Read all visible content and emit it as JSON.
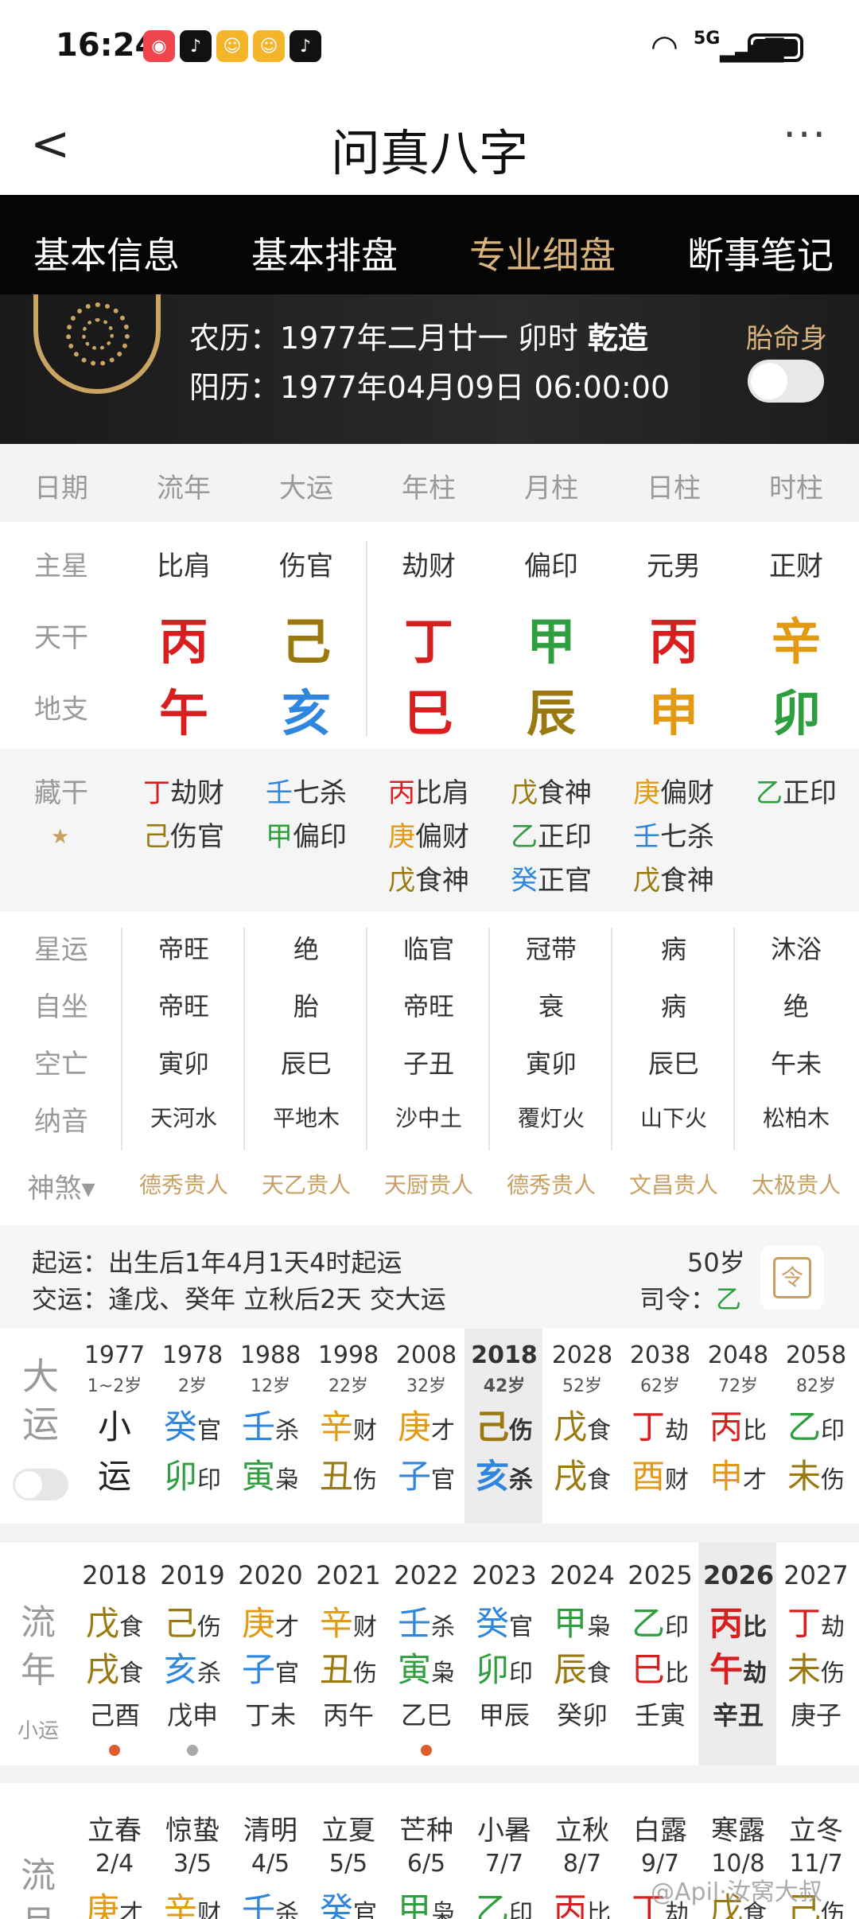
{
  "status": {
    "time": "16:24",
    "network": "5G"
  },
  "header": {
    "title": "问真八字",
    "back": "<",
    "more": "···"
  },
  "tabs": [
    {
      "label": "基本信息",
      "active": false
    },
    {
      "label": "基本排盘",
      "active": false
    },
    {
      "label": "专业细盘",
      "active": true
    },
    {
      "label": "断事笔记",
      "active": false
    }
  ],
  "info": {
    "lunar": "农历：1977年二月廿一 卯时",
    "lunar_tag": "乾造",
    "solar": "阳历：1977年04月09日 06:00:00",
    "taiming": "胎命身"
  },
  "columns": [
    "日期",
    "流年",
    "大运",
    "年柱",
    "月柱",
    "日柱",
    "时柱"
  ],
  "row_labels": {
    "zhuxing": "主星",
    "tiangan": "天干",
    "dizhi": "地支",
    "canggan": "藏干"
  },
  "zhuxing": [
    "比肩",
    "伤官",
    "劫财",
    "偏印",
    "元男",
    "正财"
  ],
  "tiangan": [
    {
      "t": "丙",
      "color": "#d81e1e"
    },
    {
      "t": "己",
      "color": "#9a7a10"
    },
    {
      "t": "丁",
      "color": "#d81e1e"
    },
    {
      "t": "甲",
      "color": "#2e9e3e"
    },
    {
      "t": "丙",
      "color": "#d81e1e"
    },
    {
      "t": "辛",
      "color": "#e39a12"
    }
  ],
  "dizhi": [
    {
      "t": "午",
      "color": "#d81e1e"
    },
    {
      "t": "亥",
      "color": "#2e86de"
    },
    {
      "t": "巳",
      "color": "#d81e1e"
    },
    {
      "t": "辰",
      "color": "#9a7a10"
    },
    {
      "t": "申",
      "color": "#e39a12"
    },
    {
      "t": "卯",
      "color": "#2e9e3e"
    }
  ],
  "canggan": [
    [
      {
        "g": "丁",
        "c": "#d81e1e",
        "s": "劫财"
      },
      {
        "g": "己",
        "c": "#9a7a10",
        "s": "伤官"
      }
    ],
    [
      {
        "g": "壬",
        "c": "#2e86de",
        "s": "七杀"
      },
      {
        "g": "甲",
        "c": "#2e9e3e",
        "s": "偏印"
      }
    ],
    [
      {
        "g": "丙",
        "c": "#d81e1e",
        "s": "比肩"
      },
      {
        "g": "庚",
        "c": "#e39a12",
        "s": "偏财"
      },
      {
        "g": "戊",
        "c": "#9a7a10",
        "s": "食神"
      }
    ],
    [
      {
        "g": "戊",
        "c": "#9a7a10",
        "s": "食神"
      },
      {
        "g": "乙",
        "c": "#2e9e3e",
        "s": "正印"
      },
      {
        "g": "癸",
        "c": "#2e86de",
        "s": "正官"
      }
    ],
    [
      {
        "g": "庚",
        "c": "#e39a12",
        "s": "偏财"
      },
      {
        "g": "壬",
        "c": "#2e86de",
        "s": "七杀"
      },
      {
        "g": "戊",
        "c": "#9a7a10",
        "s": "食神"
      }
    ],
    [
      {
        "g": "乙",
        "c": "#2e9e3e",
        "s": "正印"
      }
    ]
  ],
  "detail_labels": [
    "星运",
    "自坐",
    "空亡",
    "纳音"
  ],
  "detail": [
    [
      "帝旺",
      "绝",
      "临官",
      "冠带",
      "病",
      "沐浴"
    ],
    [
      "帝旺",
      "胎",
      "帝旺",
      "衰",
      "病",
      "绝"
    ],
    [
      "寅卯",
      "辰巳",
      "子丑",
      "寅卯",
      "辰巳",
      "午未"
    ],
    [
      "天河水",
      "平地木",
      "沙中土",
      "覆灯火",
      "山下火",
      "松柏木"
    ]
  ],
  "shensha_label": "神煞",
  "shensha": [
    "德秀贵人",
    "天乙贵人",
    "天厨贵人",
    "德秀贵人",
    "文昌贵人",
    "太极贵人"
  ],
  "qiyun": {
    "line1": "起运：出生后1年4月1天4时起运",
    "line2": "交运：逢戊、癸年 立秋后2天 交大运",
    "age": "50岁",
    "siling": "司令：",
    "siling_val": "乙",
    "icon_char": "令"
  },
  "dayun_label": [
    "大",
    "运"
  ],
  "dayun": [
    {
      "y": "1977",
      "a": "1~2岁",
      "g": "小",
      "gc": "#222",
      "gs": "",
      "z": "运",
      "zc": "#222",
      "zs": "",
      "hl": false
    },
    {
      "y": "1978",
      "a": "2岁",
      "g": "癸",
      "gc": "#2e86de",
      "gs": "官",
      "z": "卯",
      "zc": "#2e9e3e",
      "zs": "印",
      "hl": false
    },
    {
      "y": "1988",
      "a": "12岁",
      "g": "壬",
      "gc": "#2e86de",
      "gs": "杀",
      "z": "寅",
      "zc": "#2e9e3e",
      "zs": "枭",
      "hl": false
    },
    {
      "y": "1998",
      "a": "22岁",
      "g": "辛",
      "gc": "#e39a12",
      "gs": "财",
      "z": "丑",
      "zc": "#9a7a10",
      "zs": "伤",
      "hl": false
    },
    {
      "y": "2008",
      "a": "32岁",
      "g": "庚",
      "gc": "#e39a12",
      "gs": "才",
      "z": "子",
      "zc": "#2e86de",
      "zs": "官",
      "hl": false
    },
    {
      "y": "2018",
      "a": "42岁",
      "g": "己",
      "gc": "#9a7a10",
      "gs": "伤",
      "z": "亥",
      "zc": "#2e86de",
      "zs": "杀",
      "hl": true
    },
    {
      "y": "2028",
      "a": "52岁",
      "g": "戊",
      "gc": "#9a7a10",
      "gs": "食",
      "z": "戌",
      "zc": "#9a7a10",
      "zs": "食",
      "hl": false
    },
    {
      "y": "2038",
      "a": "62岁",
      "g": "丁",
      "gc": "#d81e1e",
      "gs": "劫",
      "z": "酉",
      "zc": "#e39a12",
      "zs": "财",
      "hl": false
    },
    {
      "y": "2048",
      "a": "72岁",
      "g": "丙",
      "gc": "#d81e1e",
      "gs": "比",
      "z": "申",
      "zc": "#e39a12",
      "zs": "才",
      "hl": false
    },
    {
      "y": "2058",
      "a": "82岁",
      "g": "乙",
      "gc": "#2e9e3e",
      "gs": "印",
      "z": "未",
      "zc": "#9a7a10",
      "zs": "伤",
      "hl": false
    }
  ],
  "liunian_label": [
    "流",
    "年"
  ],
  "liunian_sub": "小运",
  "liunian": [
    {
      "y": "2018",
      "g": "戊",
      "gc": "#9a7a10",
      "gs": "食",
      "z": "戌",
      "zc": "#9a7a10",
      "zs": "食",
      "x": "己酉",
      "dot": "#e05a2a",
      "hl": false
    },
    {
      "y": "2019",
      "g": "己",
      "gc": "#9a7a10",
      "gs": "伤",
      "z": "亥",
      "zc": "#2e86de",
      "zs": "杀",
      "x": "戊申",
      "dot": "#aaaaaa",
      "hl": false
    },
    {
      "y": "2020",
      "g": "庚",
      "gc": "#e39a12",
      "gs": "才",
      "z": "子",
      "zc": "#2e86de",
      "zs": "官",
      "x": "丁未",
      "dot": "",
      "hl": false
    },
    {
      "y": "2021",
      "g": "辛",
      "gc": "#e39a12",
      "gs": "财",
      "z": "丑",
      "zc": "#9a7a10",
      "zs": "伤",
      "x": "丙午",
      "dot": "",
      "hl": false
    },
    {
      "y": "2022",
      "g": "壬",
      "gc": "#2e86de",
      "gs": "杀",
      "z": "寅",
      "zc": "#2e9e3e",
      "zs": "枭",
      "x": "乙巳",
      "dot": "#e05a2a",
      "hl": false
    },
    {
      "y": "2023",
      "g": "癸",
      "gc": "#2e86de",
      "gs": "官",
      "z": "卯",
      "zc": "#2e9e3e",
      "zs": "印",
      "x": "甲辰",
      "dot": "",
      "hl": false
    },
    {
      "y": "2024",
      "g": "甲",
      "gc": "#2e9e3e",
      "gs": "枭",
      "z": "辰",
      "zc": "#9a7a10",
      "zs": "食",
      "x": "癸卯",
      "dot": "",
      "hl": false
    },
    {
      "y": "2025",
      "g": "乙",
      "gc": "#2e9e3e",
      "gs": "印",
      "z": "巳",
      "zc": "#d81e1e",
      "zs": "比",
      "x": "壬寅",
      "dot": "",
      "hl": false
    },
    {
      "y": "2026",
      "g": "丙",
      "gc": "#d81e1e",
      "gs": "比",
      "z": "午",
      "zc": "#d81e1e",
      "zs": "劫",
      "x": "辛丑",
      "dot": "",
      "hl": true
    },
    {
      "y": "2027",
      "g": "丁",
      "gc": "#d81e1e",
      "gs": "劫",
      "z": "未",
      "zc": "#9a7a10",
      "zs": "伤",
      "x": "庚子",
      "dot": "",
      "hl": false
    }
  ],
  "liuyue_label": [
    "流",
    "月"
  ],
  "liuyue": [
    {
      "j": "立春",
      "d": "2/4",
      "g": "庚",
      "gc": "#e39a12",
      "gs": "才"
    },
    {
      "j": "惊蛰",
      "d": "3/5",
      "g": "辛",
      "gc": "#e39a12",
      "gs": "财"
    },
    {
      "j": "清明",
      "d": "4/5",
      "g": "壬",
      "gc": "#2e86de",
      "gs": "杀"
    },
    {
      "j": "立夏",
      "d": "5/5",
      "g": "癸",
      "gc": "#2e86de",
      "gs": "官"
    },
    {
      "j": "芒种",
      "d": "6/5",
      "g": "甲",
      "gc": "#2e9e3e",
      "gs": "枭"
    },
    {
      "j": "小暑",
      "d": "7/7",
      "g": "乙",
      "gc": "#2e9e3e",
      "gs": "印"
    },
    {
      "j": "立秋",
      "d": "8/7",
      "g": "丙",
      "gc": "#d81e1e",
      "gs": "比"
    },
    {
      "j": "白露",
      "d": "9/7",
      "g": "丁",
      "gc": "#d81e1e",
      "gs": "劫"
    },
    {
      "j": "寒露",
      "d": "10/8",
      "g": "戊",
      "gc": "#9a7a10",
      "gs": "食"
    },
    {
      "j": "立冬",
      "d": "11/7",
      "g": "己",
      "gc": "#9a7a10",
      "gs": "伤"
    }
  ],
  "watermark": "@Apil·汝窝大叔"
}
